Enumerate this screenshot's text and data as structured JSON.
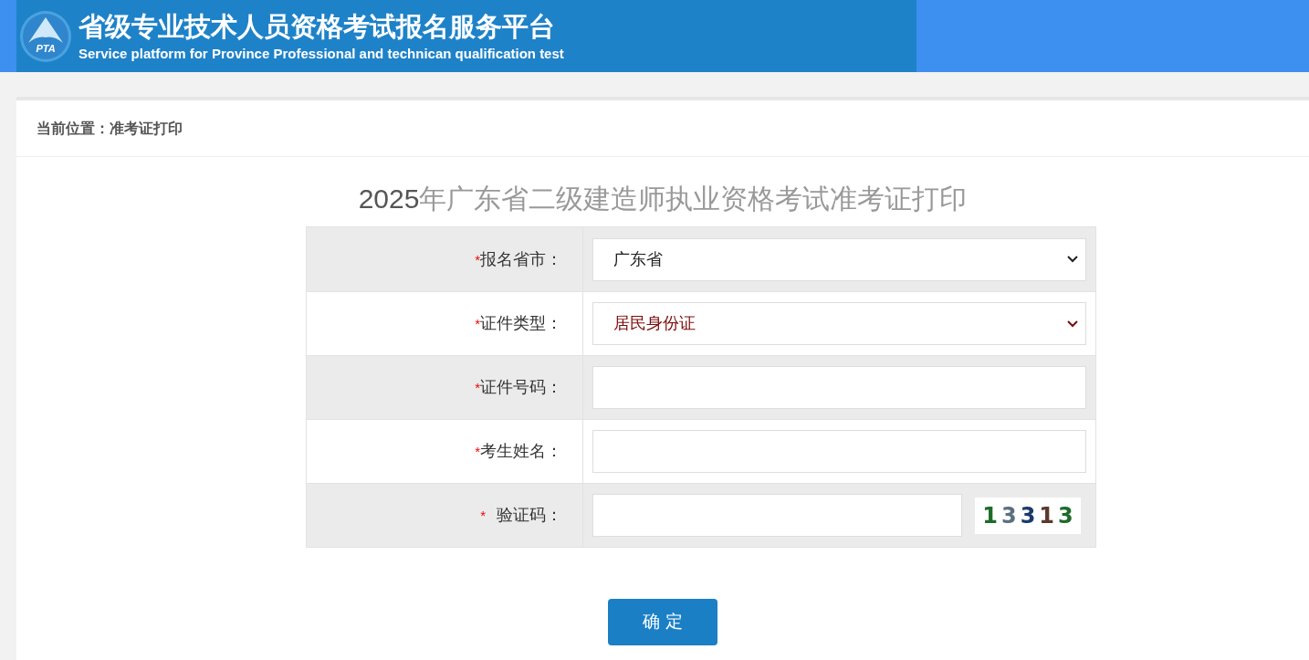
{
  "header": {
    "logo_text": "PTA",
    "title": "省级专业技术人员资格考试报名服务平台",
    "subtitle": "Service platform for Province Professional and technican qualification test"
  },
  "breadcrumb": "当前位置：准考证打印",
  "form_title": {
    "highlight": "2025",
    "text": "年广东省二级建造师执业资格考试准考证打印"
  },
  "fields": [
    {
      "kind": "select",
      "required_mark": "*",
      "label": "报名省市：",
      "value": "广东省",
      "color": "#222222"
    },
    {
      "kind": "select",
      "required_mark": "*",
      "label": "证件类型：",
      "value": "居民身份证",
      "color": "#7a0c0c"
    },
    {
      "kind": "input",
      "required_mark": "*",
      "label": "证件号码："
    },
    {
      "kind": "input",
      "required_mark": "*",
      "label": "考生姓名："
    },
    {
      "kind": "captcha",
      "required_mark": "*",
      "label": "验证码：",
      "captcha": "13313"
    }
  ],
  "submit": "确 定"
}
